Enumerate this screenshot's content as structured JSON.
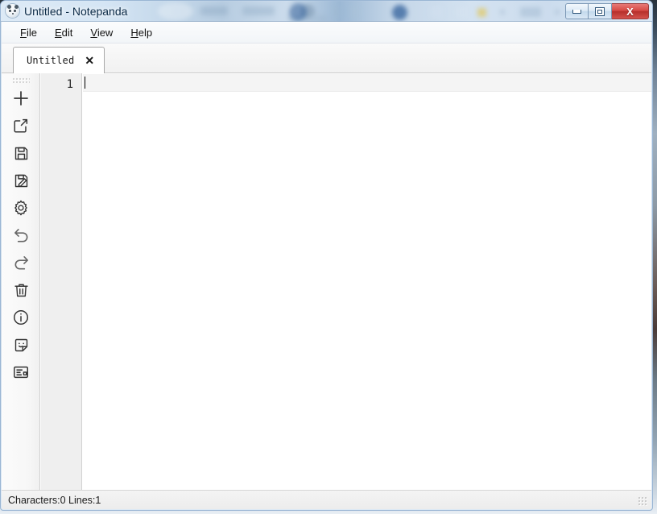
{
  "window": {
    "title": "Untitled - Notepanda",
    "app_icon": "panda-icon",
    "controls": {
      "minimize": "minimize-icon",
      "maximize": "maximize-icon",
      "close_label": "X"
    }
  },
  "menubar": {
    "items": [
      {
        "mnemonic": "F",
        "rest": "ile",
        "name": "menu-file"
      },
      {
        "mnemonic": "E",
        "rest": "dit",
        "name": "menu-edit"
      },
      {
        "mnemonic": "V",
        "rest": "iew",
        "name": "menu-view"
      },
      {
        "mnemonic": "H",
        "rest": "elp",
        "name": "menu-help"
      }
    ]
  },
  "tabs": [
    {
      "label": "Untitled",
      "close_label": "✕",
      "active": true
    }
  ],
  "toolbar": {
    "items": [
      {
        "name": "new-file-icon",
        "icon": "plus",
        "tooltip": "New"
      },
      {
        "name": "open-file-icon",
        "icon": "open",
        "tooltip": "Open"
      },
      {
        "name": "save-icon",
        "icon": "save",
        "tooltip": "Save"
      },
      {
        "name": "save-as-icon",
        "icon": "save-as",
        "tooltip": "Save As"
      },
      {
        "name": "settings-icon",
        "icon": "gear",
        "tooltip": "Settings"
      },
      {
        "name": "undo-icon",
        "icon": "undo",
        "tooltip": "Undo"
      },
      {
        "name": "redo-icon",
        "icon": "redo",
        "tooltip": "Redo"
      },
      {
        "name": "delete-icon",
        "icon": "trash",
        "tooltip": "Delete"
      },
      {
        "name": "about-icon",
        "icon": "info",
        "tooltip": "About"
      },
      {
        "name": "sticker-icon",
        "icon": "sticker",
        "tooltip": "Sticker"
      },
      {
        "name": "layout-icon",
        "icon": "layout",
        "tooltip": "Layout"
      }
    ]
  },
  "editor": {
    "line_numbers": [
      "1"
    ],
    "content": "",
    "current_line": 1
  },
  "statusbar": {
    "text": "Characters:0 Lines:1",
    "characters": 0,
    "lines": 1
  },
  "colors": {
    "frame": "#9ab6d4",
    "close_button": "#d64a45",
    "toolbar_bg": "#f7f7f7",
    "gutter_bg": "#efefef",
    "editor_bg": "#ffffff",
    "current_line": "#f4f4f4"
  }
}
